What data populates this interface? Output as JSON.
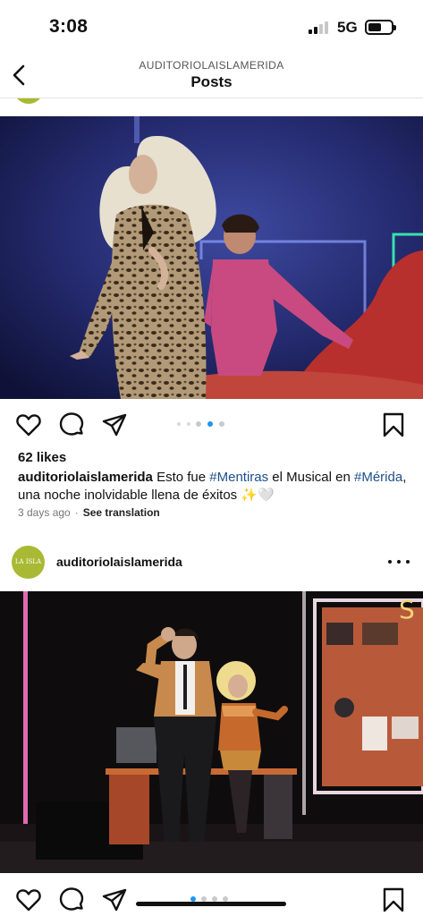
{
  "status_bar": {
    "time": "3:08",
    "network": "5G"
  },
  "nav": {
    "account": "AUDITORIOLAISLAMERIDA",
    "title": "Posts"
  },
  "post1": {
    "likes": "62 likes",
    "username": "auditoriolaislamerida",
    "caption_parts": [
      "Esto fue ",
      "#Mentiras",
      " el Musical en ",
      "#Mérida",
      ", una noche inolvidable llena de éxitos ✨🤍"
    ],
    "timestamp": "3 days ago",
    "separator": "·",
    "translate": "See translation",
    "carousel": {
      "count": 5,
      "active_index": 3
    }
  },
  "post2": {
    "username": "auditoriolaislamerida",
    "avatar_text": "LA ISLA",
    "carousel": {
      "count": 4,
      "active_index": 0
    }
  },
  "colors": {
    "accent_blue": "#1e95f2",
    "avatar_green": "#a9b933",
    "hashtag": "#1d4f8a"
  },
  "icons": [
    "back-chevron-icon",
    "heart-icon",
    "comment-icon",
    "share-icon",
    "bookmark-icon",
    "more-icon"
  ]
}
